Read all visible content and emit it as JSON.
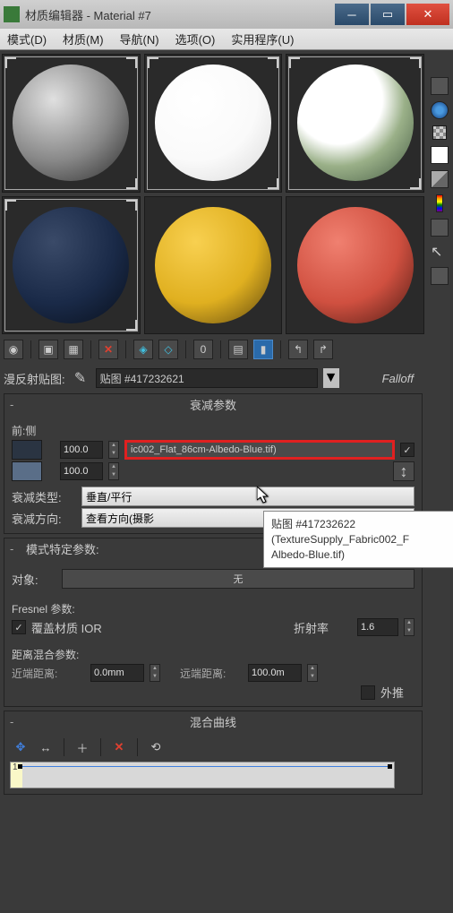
{
  "window": {
    "title": "材质编辑器 - Material #7"
  },
  "menu": {
    "mode": "模式(D)",
    "material": "材质(M)",
    "navigate": "导航(N)",
    "options": "选项(O)",
    "utilities": "实用程序(U)"
  },
  "diffuse_row": {
    "label": "漫反射贴图:",
    "map_name": "贴图 #417232621",
    "falloff": "Falloff"
  },
  "rollout_falloff": {
    "title": "衰减参数",
    "front_side": "前:侧",
    "value1": "100.0",
    "map1": "ic002_Flat_86cm-Albedo-Blue.tif)",
    "check1": "✓",
    "value2": "100.0",
    "falloff_type_label": "衰减类型:",
    "falloff_type_value": "垂直/平行",
    "falloff_dir_label": "衰减方向:",
    "falloff_dir_value": "查看方向(摄影"
  },
  "tooltip": {
    "line1": "贴图 #417232622",
    "line2": "(TextureSupply_Fabric002_F",
    "line3": "Albedo-Blue.tif)"
  },
  "rollout_mode": {
    "title": "模式特定参数:",
    "object_label": "对象:",
    "object_value": "无",
    "fresnel_label": "Fresnel 参数:",
    "override_ior": "覆盖材质 IOR",
    "index_label": "折射率",
    "index_value": "1.6",
    "distance_label": "距离混合参数:",
    "near_label": "近端距离:",
    "near_value": "0.0mm",
    "far_label": "远端距离:",
    "far_value": "100.0m",
    "extrapolate": "外推"
  },
  "rollout_curve": {
    "title": "混合曲线",
    "yaxis": "1"
  }
}
